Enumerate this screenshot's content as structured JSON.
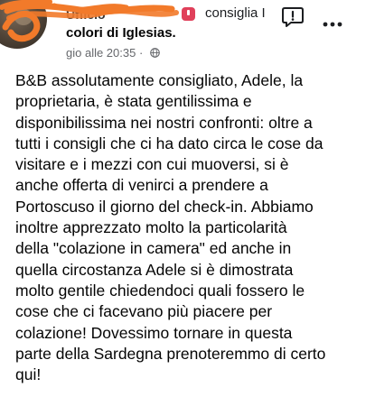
{
  "header": {
    "author_name": "Ufficio",
    "recommends_text": "consiglia I",
    "recommends_text_line2": "colori di Iglesias.",
    "timestamp": "gio alle 20:35",
    "separator": "·"
  },
  "icons": {
    "avatar": "avatar",
    "badge": "recommend-badge-icon",
    "privacy": "globe-icon",
    "report": "report-flag-icon",
    "more": "more-options-icon",
    "accent": "#e0405a",
    "redaction": "#f27a2a"
  },
  "post": {
    "lines": [
      "B&B assolutamente consigliato, Adele, la",
      "proprietaria, è stata gentilissima e",
      "disponibilissima nei nostri confronti: oltre a",
      "tutti i consigli che ci ha dato circa le cose da",
      "visitare e i mezzi con cui muoversi, si è",
      "anche offerta di venirci a prendere a",
      "Portoscuso il giorno del check-in. Abbiamo",
      "inoltre apprezzato molto la particolarità",
      "della \"colazione in camera\" ed anche in",
      "quella circostanza Adele si è dimostrata",
      "molto gentile chiedendoci quali fossero le",
      "cose che ci facevano più piacere per",
      "colazione! Dovessimo tornare in questa",
      "parte della Sardegna prenoteremmo di certo",
      "qui!"
    ]
  }
}
